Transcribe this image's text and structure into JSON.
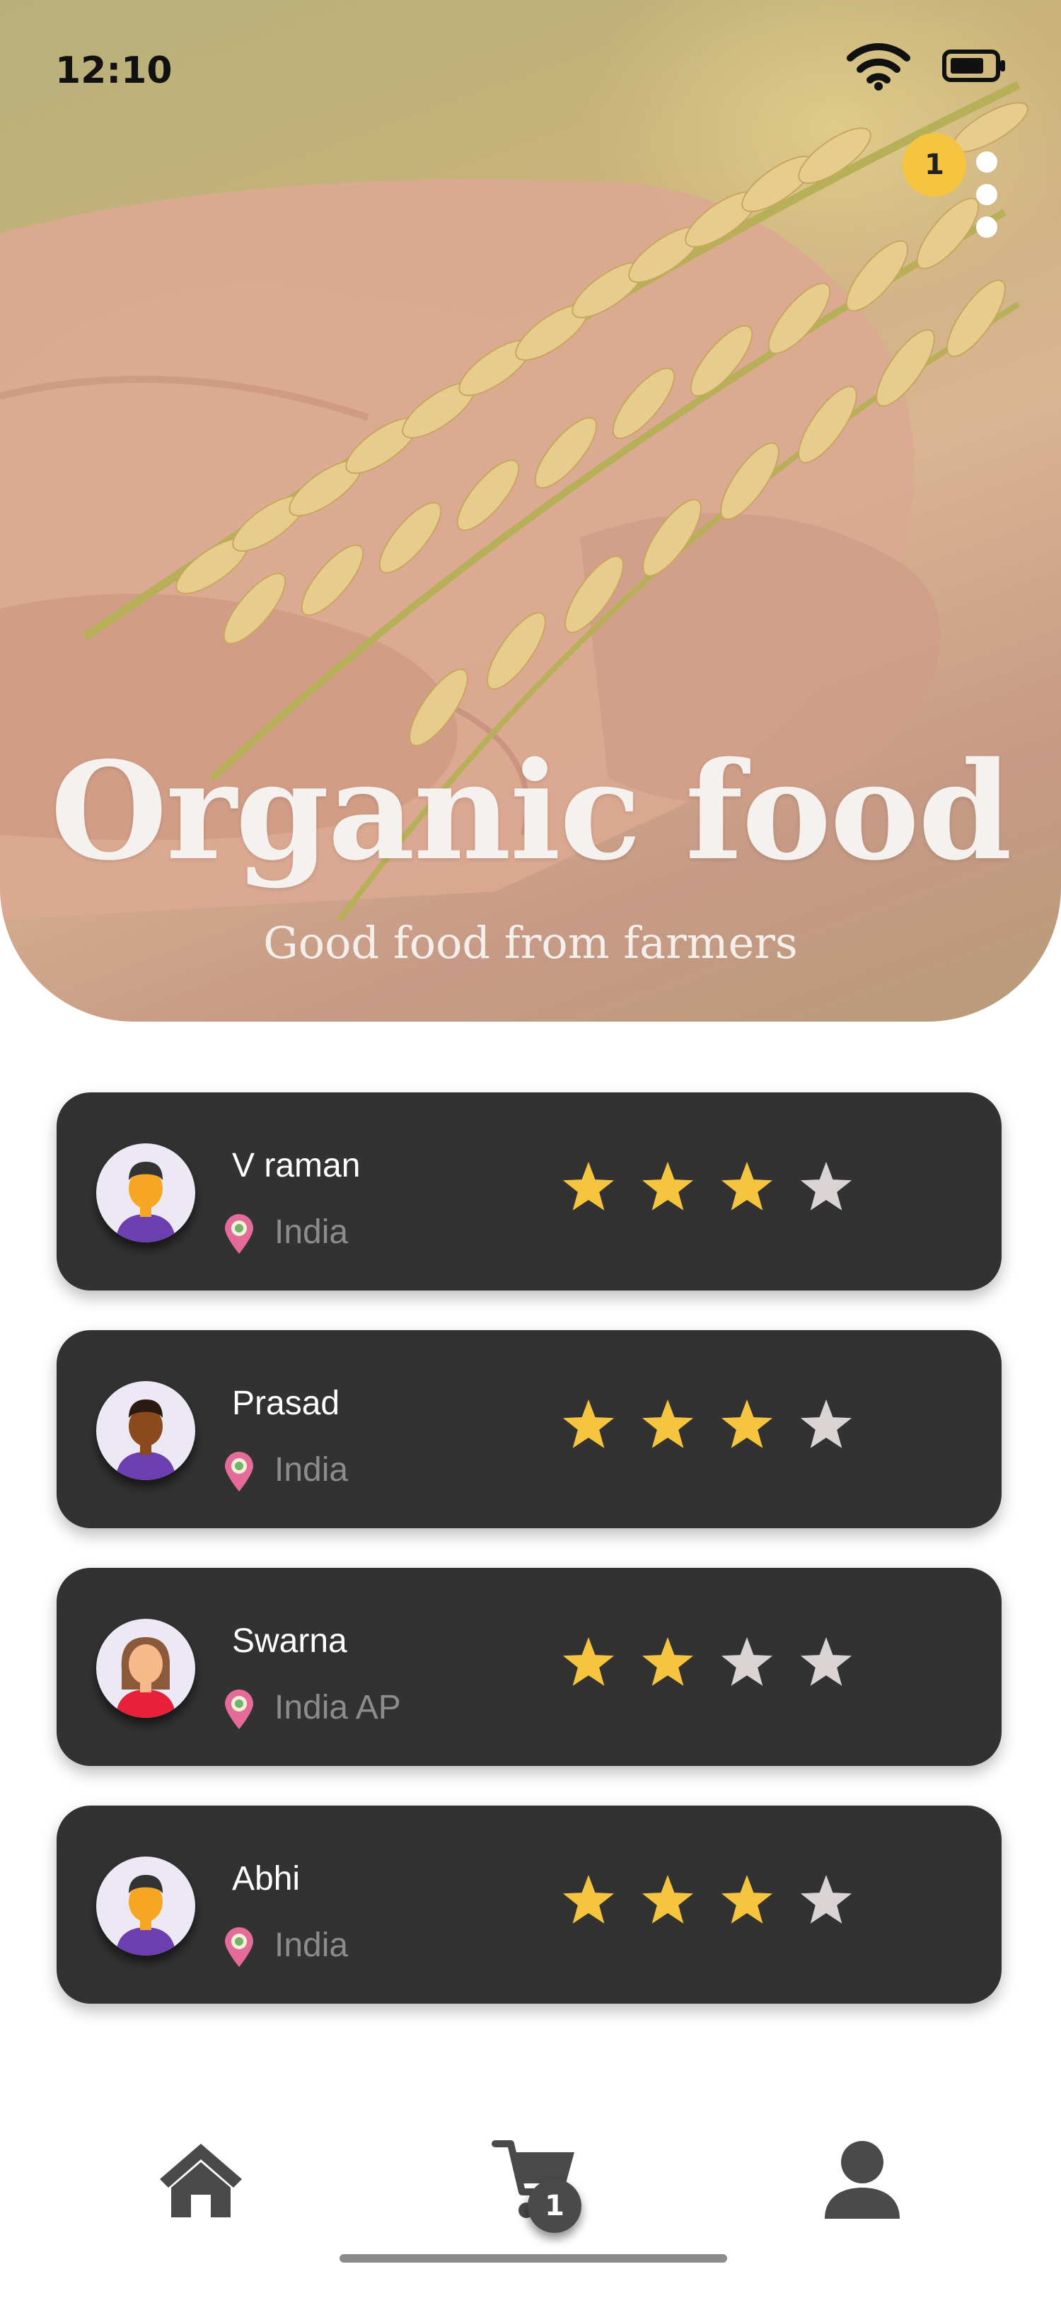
{
  "status_bar": {
    "time": "12:10"
  },
  "hero": {
    "title": "Organic food",
    "subtitle": "Good food from farmers",
    "notification_count": "1"
  },
  "farmers": [
    {
      "name": "V raman",
      "location": "India",
      "rating": 3,
      "max_rating": 4,
      "avatar": "male-avatar-light"
    },
    {
      "name": "Prasad",
      "location": "India",
      "rating": 3,
      "max_rating": 4,
      "avatar": "male-avatar-dark"
    },
    {
      "name": "Swarna",
      "location": "India AP",
      "rating": 2,
      "max_rating": 4,
      "avatar": "female-avatar"
    },
    {
      "name": "Abhi",
      "location": "India",
      "rating": 3,
      "max_rating": 4,
      "avatar": "male-avatar-light"
    }
  ],
  "bottom_nav": {
    "items": [
      {
        "icon": "home-icon"
      },
      {
        "icon": "cart-icon",
        "badge": "1"
      },
      {
        "icon": "person-icon"
      }
    ]
  },
  "colors": {
    "card_bg": "#333232",
    "star_filled": "#f6c53f",
    "star_empty": "#d9d3d3",
    "badge": "#f6c53f",
    "nav_icon": "#4a4a4a"
  }
}
